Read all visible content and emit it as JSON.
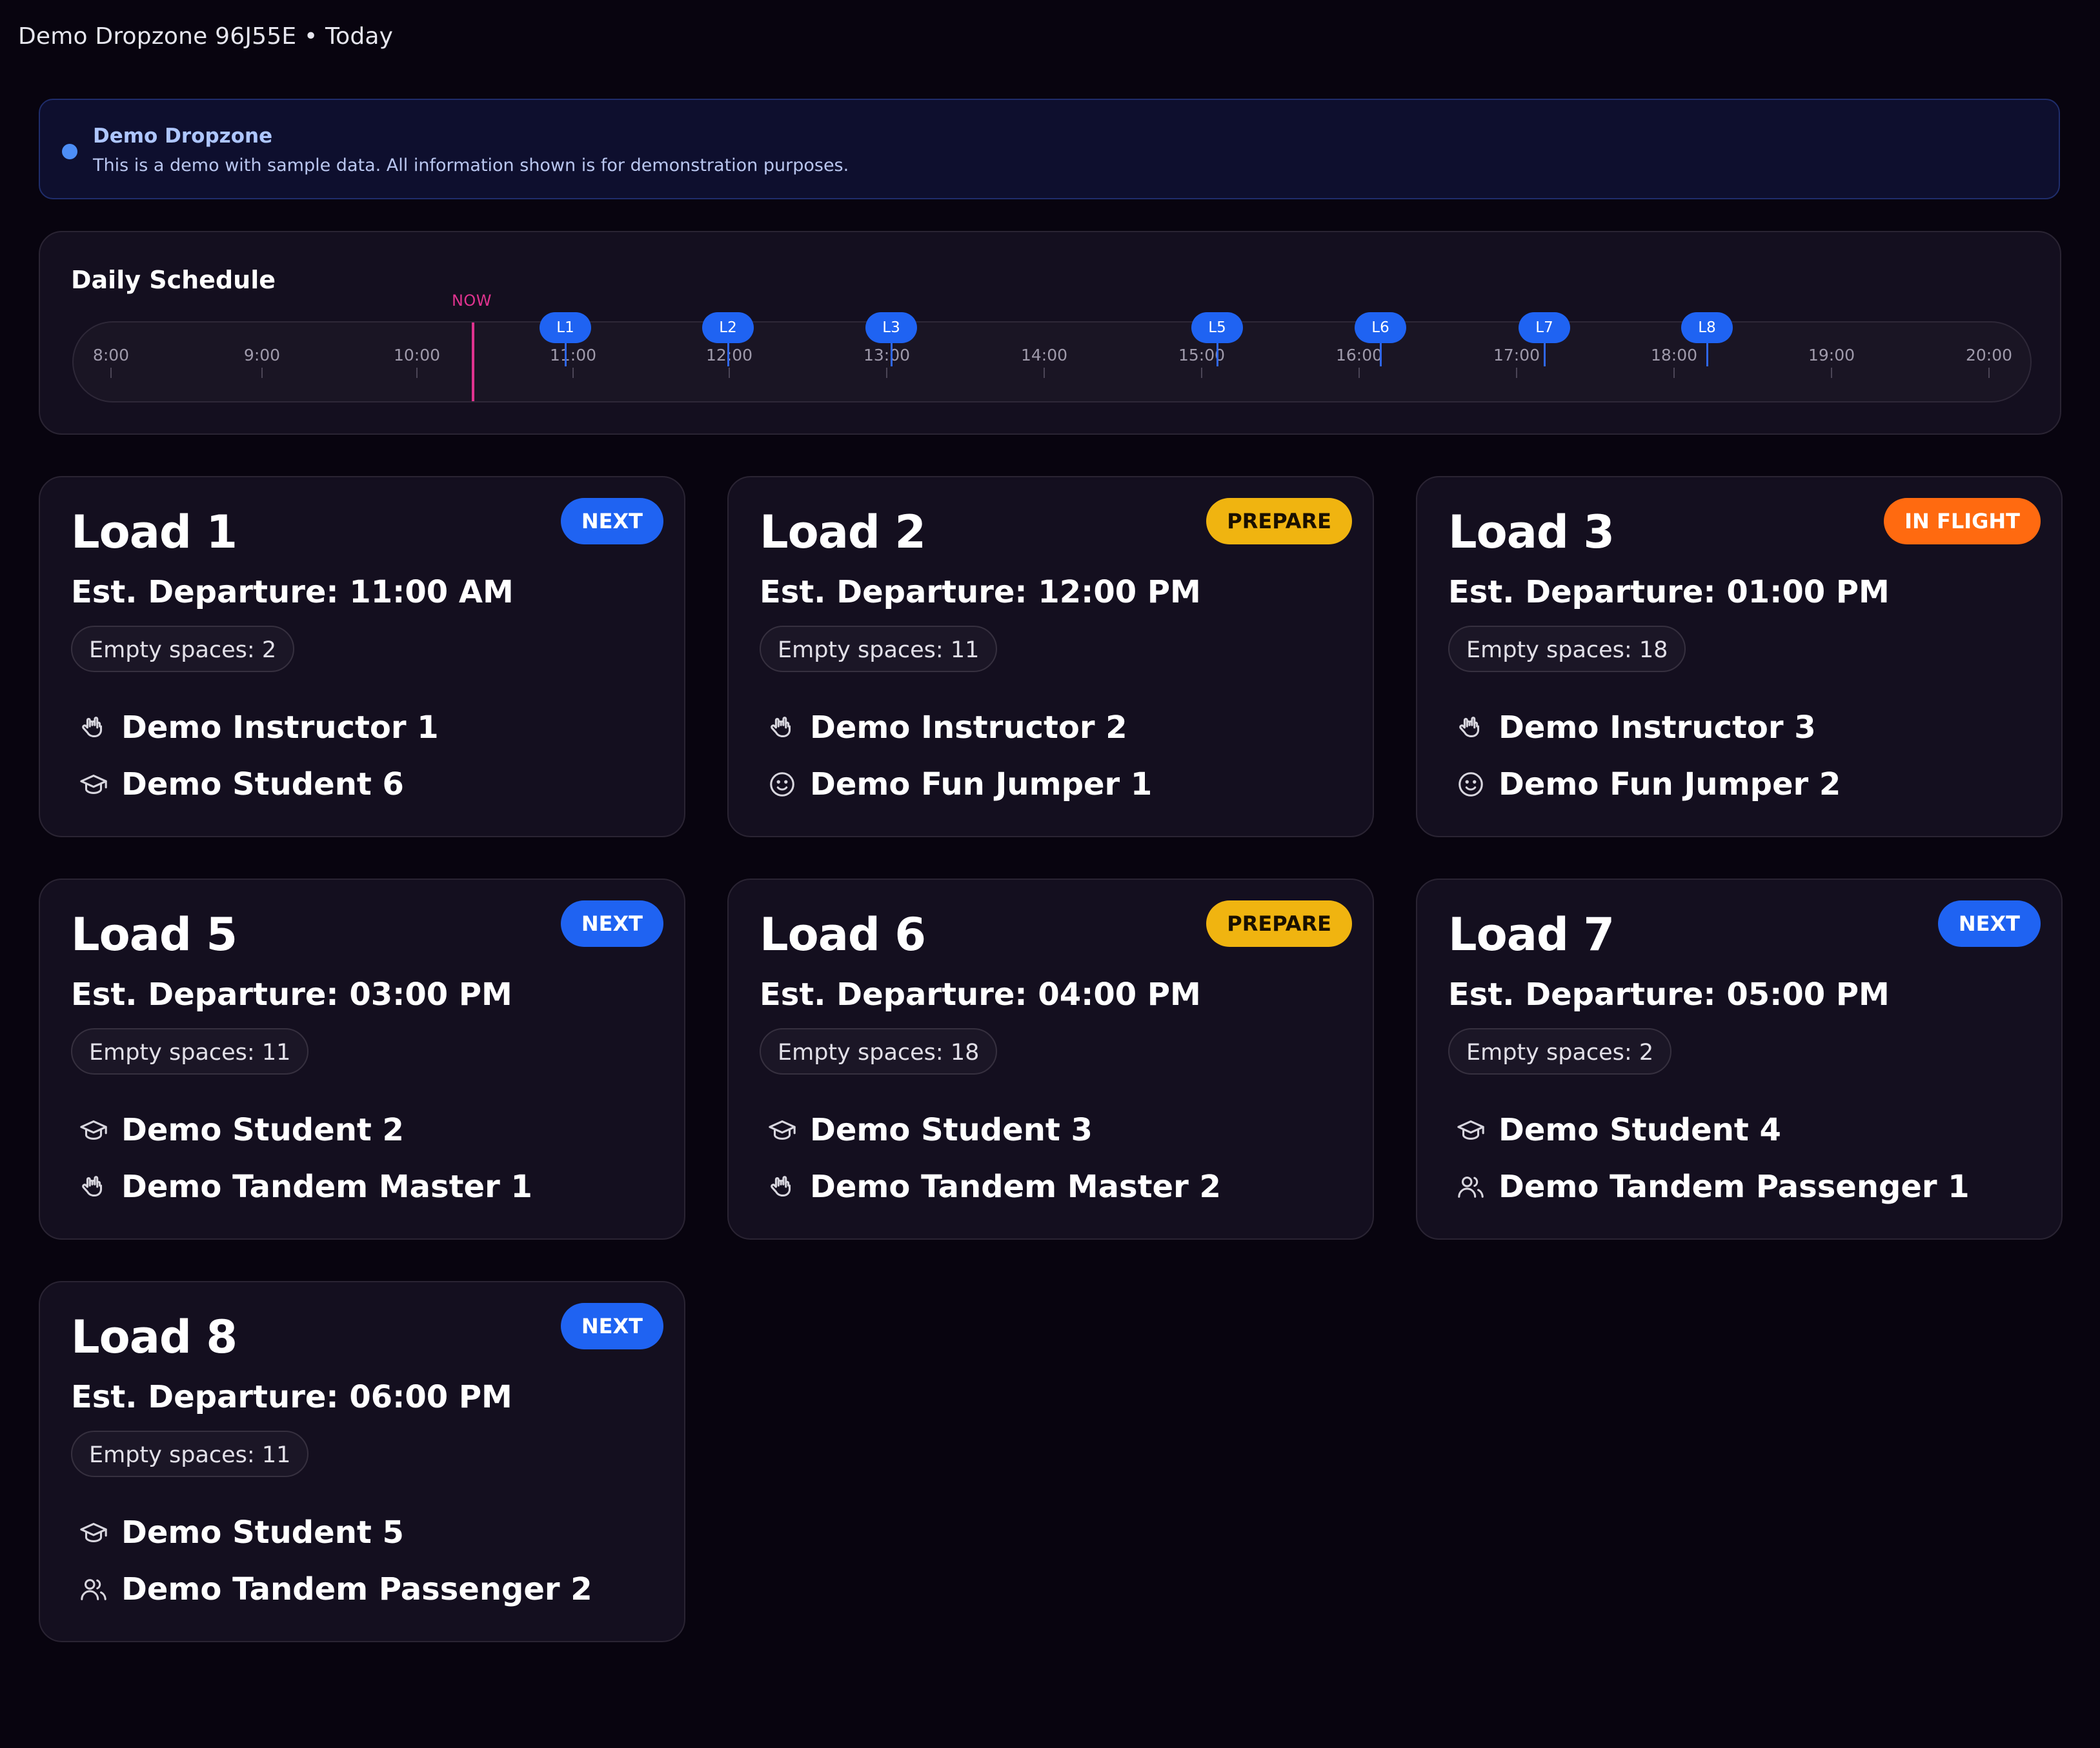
{
  "header": {
    "title": "Demo Dropzone 96J55E • Today"
  },
  "banner": {
    "title": "Demo Dropzone",
    "text": "This is a demo with sample data. All information shown is for demonstration purposes."
  },
  "schedule": {
    "title": "Daily Schedule",
    "now_label": "NOW",
    "hours": [
      "8:00",
      "9:00",
      "10:00",
      "11:00",
      "12:00",
      "13:00",
      "14:00",
      "15:00",
      "16:00",
      "17:00",
      "18:00",
      "19:00",
      "20:00"
    ],
    "loads": [
      "L1",
      "L2",
      "L3",
      "L5",
      "L6",
      "L7",
      "L8"
    ]
  },
  "loads": [
    {
      "title": "Load 1",
      "status": "NEXT",
      "departure": "Est. Departure: 11:00 AM",
      "spaces": "Empty spaces: 2",
      "jumpers": [
        {
          "name": "Demo Instructor 1",
          "icon": "hand-rock-icon"
        },
        {
          "name": "Demo Student 6",
          "icon": "graduation-cap-icon"
        }
      ]
    },
    {
      "title": "Load 2",
      "status": "PREPARE",
      "departure": "Est. Departure: 12:00 PM",
      "spaces": "Empty spaces: 11",
      "jumpers": [
        {
          "name": "Demo Instructor 2",
          "icon": "hand-rock-icon"
        },
        {
          "name": "Demo Fun Jumper 1",
          "icon": "smiley-icon"
        }
      ]
    },
    {
      "title": "Load 3",
      "status": "IN FLIGHT",
      "departure": "Est. Departure: 01:00 PM",
      "spaces": "Empty spaces: 18",
      "jumpers": [
        {
          "name": "Demo Instructor 3",
          "icon": "hand-rock-icon"
        },
        {
          "name": "Demo Fun Jumper 2",
          "icon": "smiley-icon"
        }
      ]
    },
    {
      "title": "Load 5",
      "status": "NEXT",
      "departure": "Est. Departure: 03:00 PM",
      "spaces": "Empty spaces: 11",
      "jumpers": [
        {
          "name": "Demo Student 2",
          "icon": "graduation-cap-icon"
        },
        {
          "name": "Demo Tandem Master 1",
          "icon": "hand-rock-icon"
        }
      ]
    },
    {
      "title": "Load 6",
      "status": "PREPARE",
      "departure": "Est. Departure: 04:00 PM",
      "spaces": "Empty spaces: 18",
      "jumpers": [
        {
          "name": "Demo Student 3",
          "icon": "graduation-cap-icon"
        },
        {
          "name": "Demo Tandem Master 2",
          "icon": "hand-rock-icon"
        }
      ]
    },
    {
      "title": "Load 7",
      "status": "NEXT",
      "departure": "Est. Departure: 05:00 PM",
      "spaces": "Empty spaces: 2",
      "jumpers": [
        {
          "name": "Demo Student 4",
          "icon": "graduation-cap-icon"
        },
        {
          "name": "Demo Tandem Passenger 1",
          "icon": "users-icon"
        }
      ]
    },
    {
      "title": "Load 8",
      "status": "NEXT",
      "departure": "Est. Departure: 06:00 PM",
      "spaces": "Empty spaces: 11",
      "jumpers": [
        {
          "name": "Demo Student 5",
          "icon": "graduation-cap-icon"
        },
        {
          "name": "Demo Tandem Passenger 2",
          "icon": "users-icon"
        }
      ]
    }
  ],
  "colors": {
    "background": "#08040f",
    "card": "#140f1f",
    "accent_blue": "#1f63f2",
    "prepare_yellow": "#f0b410",
    "in_flight_orange": "#ff6a10",
    "now_pink": "#e0338f"
  }
}
